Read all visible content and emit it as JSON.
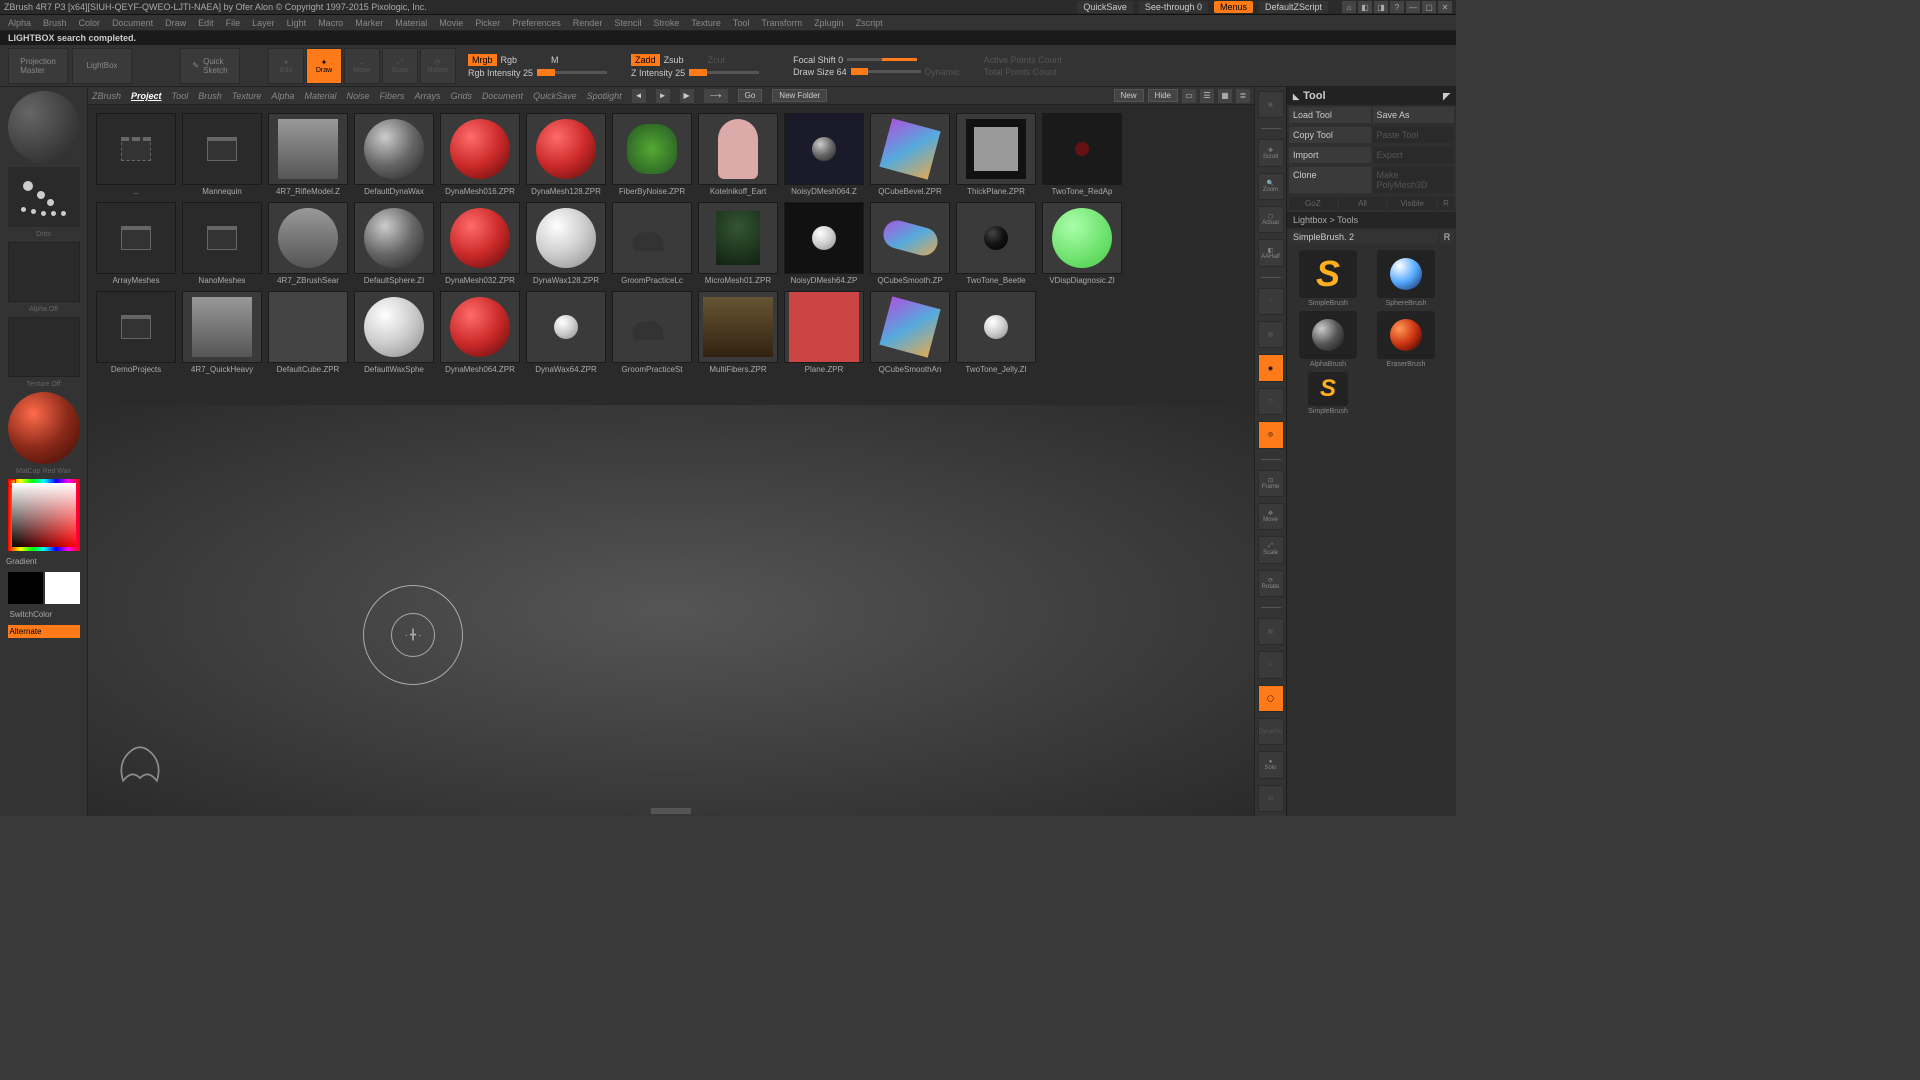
{
  "titlebar": {
    "text": "ZBrush 4R7 P3 [x64][SIUH-QEYF-QWEO-LJTI-NAEA] by Ofer Alon © Copyright 1997-2015 Pixologic, Inc.",
    "quicksave": "QuickSave",
    "seethrough": "See-through  0",
    "menus": "Menus",
    "defaultzscript": "DefaultZScript"
  },
  "menubar": [
    "Alpha",
    "Brush",
    "Color",
    "Document",
    "Draw",
    "Edit",
    "File",
    "Layer",
    "Light",
    "Macro",
    "Marker",
    "Material",
    "Movie",
    "Picker",
    "Preferences",
    "Render",
    "Stencil",
    "Stroke",
    "Texture",
    "Tool",
    "Transform",
    "Zplugin",
    "Zscript"
  ],
  "status": "LIGHTBOX search completed.",
  "toolbar": {
    "projection": "Projection\nMaster",
    "lightbox": "LightBox",
    "quicksketch": "Quick\nSketch",
    "draw": "Draw",
    "mrgb": "Mrgb",
    "rgb": "Rgb",
    "m": "M",
    "rgbint": "Rgb Intensity 25",
    "zadd": "Zadd",
    "zsub": "Zsub",
    "zcut": "Zcut",
    "zint": "Z Intensity 25",
    "focal": "Focal Shift 0",
    "drawsize": "Draw Size 64",
    "dynamic": "Dynamic",
    "apc": "Active Points Count",
    "tpc": "Total Points Count"
  },
  "left": {
    "stroke": "Dots",
    "alpha": "Alpha Off",
    "texture": "Texture Off",
    "matcap": "MatCap Red Wax",
    "gradient": "Gradient",
    "switch": "SwitchColor",
    "alternate": "Alternate"
  },
  "lightbox": {
    "tabs": [
      "ZBrush",
      "Project",
      "Tool",
      "Brush",
      "Texture",
      "Alpha",
      "Material",
      "Noise",
      "Fibers",
      "Arrays",
      "Grids",
      "Document",
      "QuickSave",
      "Spotlight"
    ],
    "active_tab": 1,
    "go": "Go",
    "newfolder": "New Folder",
    "new": "New",
    "hide": "Hide",
    "row1": [
      "..",
      "Mannequin",
      "4R7_RifleModel.Z",
      "DefaultDynaWax",
      "DynaMesh016.ZPR",
      "DynaMesh128.ZPR",
      "FiberByNoise.ZPR",
      "Kotelnikoff_Eart",
      "NoisyDMesh064.Z",
      "QCubeBevel.ZPR",
      "ThickPlane.ZPR",
      "TwoTone_RedAp"
    ],
    "row2": [
      "ArrayMeshes",
      "NanoMeshes",
      "4R7_ZBrushSear",
      "DefaultSphere.ZI",
      "DynaMesh032.ZPR",
      "DynaWax128.ZPR",
      "GroomPracticeLc",
      "MicroMesh01.ZPR",
      "NoisyDMesh64.ZP",
      "QCubeSmooth.ZP",
      "TwoTone_Beetle",
      "VDispDiagnosic.Zl"
    ],
    "row3": [
      "DemoProjects",
      "4R7_QuickHeavy",
      "DefaultCube.ZPR",
      "DefaultWaxSphe",
      "DynaMesh064.ZPR",
      "DynaWax64.ZPR",
      "GroomPracticeSt",
      "MultiFibers.ZPR",
      "Plane.ZPR",
      "QCubeSmoothAn",
      "TwoTone_Jelly.ZI"
    ]
  },
  "rightdock": {
    "scroll": "Scroll",
    "zoom": "Zoom",
    "actual": "Actual",
    "aahalf": "AAHalf",
    "frame": "Frame",
    "move": "Move",
    "scale": "Scale",
    "rotate": "Rotate",
    "dynamic": "Dynamic",
    "solo": "Solo"
  },
  "rightpanel": {
    "title": "Tool",
    "load": "Load Tool",
    "save": "Save As",
    "copy": "Copy Tool",
    "paste": "Paste Tool",
    "import": "Import",
    "export": "Export",
    "clone": "Clone",
    "makepoly": "Make PolyMesh3D",
    "gop": "GoZ",
    "all": "All",
    "visible": "Visible",
    "r": "R",
    "section": "Lightbox > Tools",
    "current": "SimpleBrush. 2",
    "currentR": "R",
    "brushes": [
      {
        "name": "SimpleBrush"
      },
      {
        "name": "SphereBrush"
      },
      {
        "name": "AlphaBrush"
      },
      {
        "name": "EraserBrush"
      },
      {
        "name": "SimpleBrush"
      }
    ]
  }
}
